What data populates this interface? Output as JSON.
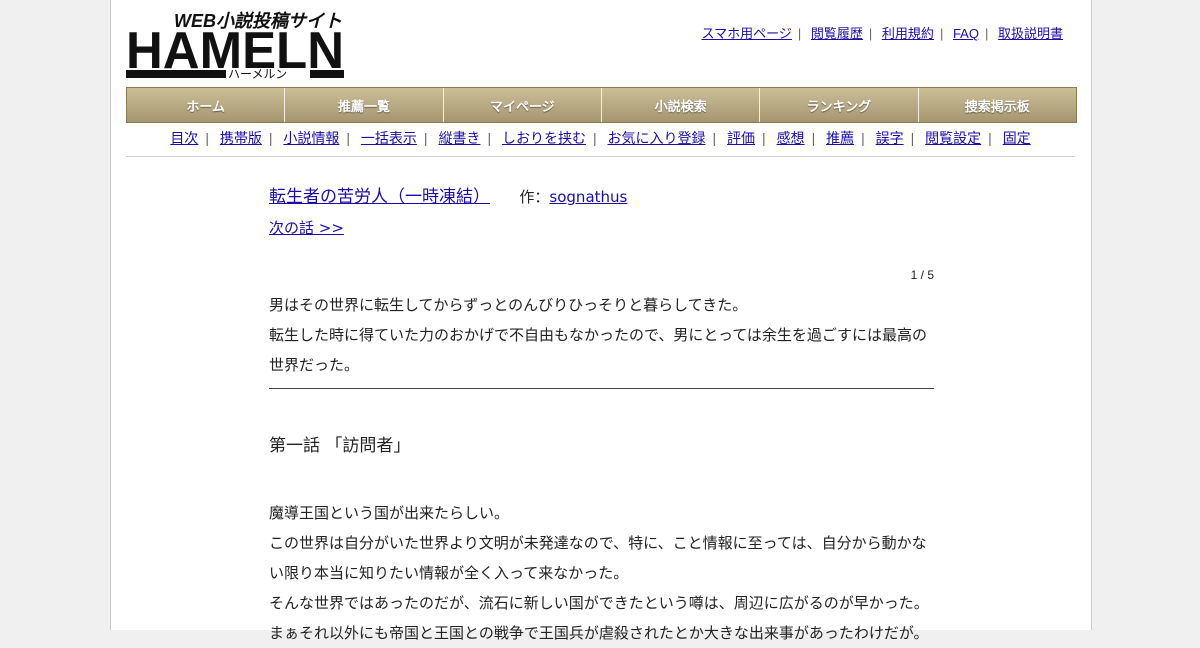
{
  "logo": {
    "text": "HAMELN",
    "tagline": "WEB小説投稿サイト",
    "reading": "ハーメルン"
  },
  "top_links": [
    "スマホ用ページ",
    "閲覧履歴",
    "利用規約",
    "FAQ",
    "取扱説明書"
  ],
  "main_nav": [
    "ホーム",
    "推薦一覧",
    "マイページ",
    "小説検索",
    "ランキング",
    "捜索掲示板"
  ],
  "sub_nav": [
    "目次",
    "携帯版",
    "小説情報",
    "一括表示",
    "縦書き",
    "しおりを挟む",
    "お気に入り登録",
    "評価",
    "感想",
    "推薦",
    "誤字",
    "閲覧設定",
    "固定"
  ],
  "novel": {
    "title": "転生者の苦労人（一時凍結）",
    "author_prefix": "作：",
    "author": "sognathus",
    "next_link": "次の話 >>",
    "page_count": "1 / 5",
    "preface": [
      "男はその世界に転生してからずっとのんびりひっそりと暮らしてきた。",
      "転生した時に得ていた力のおかげで不自由もなかったので、男にとっては余生を過ごすには最高の世界だった。"
    ],
    "chapter_title": "第一話 「訪問者」",
    "body": [
      "魔導王国という国が出来たらしい。",
      "この世界は自分がいた世界より文明が未発達なので、特に、こと情報に至っては、自分から動かない限り本当に知りたい情報が全く入って来なかった。",
      "そんな世界ではあったのだが、流石に新しい国ができたという噂は、周辺に広がるのが早かった。",
      "まぁそれ以外にも帝国と王国との戦争で王国兵が虐殺されたとか大きな出来事があったわけだが。"
    ]
  }
}
